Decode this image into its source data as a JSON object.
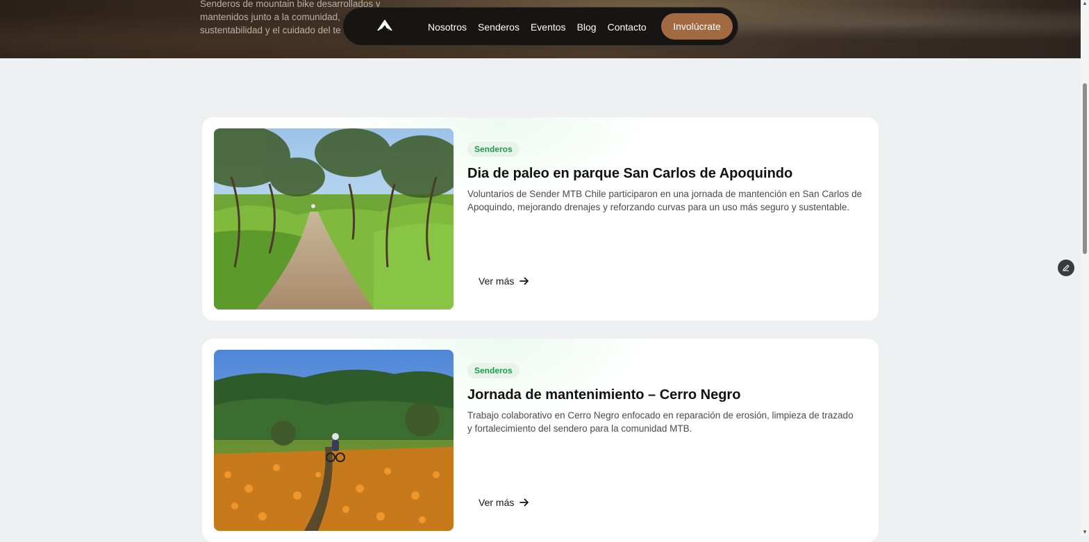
{
  "hero": {
    "lines": [
      "Senderos de mountain bike desarrollados y",
      "mantenidos junto a la comunidad,",
      "sustentabilidad y el cuidado del te"
    ]
  },
  "nav": {
    "logo_icon": "mountain-logo-icon",
    "links": [
      "Nosotros",
      "Senderos",
      "Eventos",
      "Blog",
      "Contacto"
    ],
    "cta": "Involúcrate"
  },
  "posts": [
    {
      "tag": "Senderos",
      "title": "Dia de paleo en parque San Carlos de Apoquindo",
      "description_lines": [
        "Voluntarios de Sender MTB Chile participaron en una jornada de mantención en San Carlos de",
        "Apoquindo, mejorando drenajes y reforzando curvas para un uso más seguro y sustentable."
      ],
      "more": "Ver más"
    },
    {
      "tag": "Senderos",
      "title": "Jornada de mantenimiento – Cerro Negro",
      "description_lines": [
        "Trabajo colaborativo en Cerro Negro enfocado en reparación de erosión, limpieza de trazado",
        "y fortalecimiento del sendero para la comunidad MTB."
      ],
      "more": "Ver más"
    }
  ],
  "colors": {
    "accent": "#a26a41",
    "tag_text": "#1f9a48",
    "tag_bg": "#e8f4ea",
    "page_bg": "#eff0f1"
  }
}
